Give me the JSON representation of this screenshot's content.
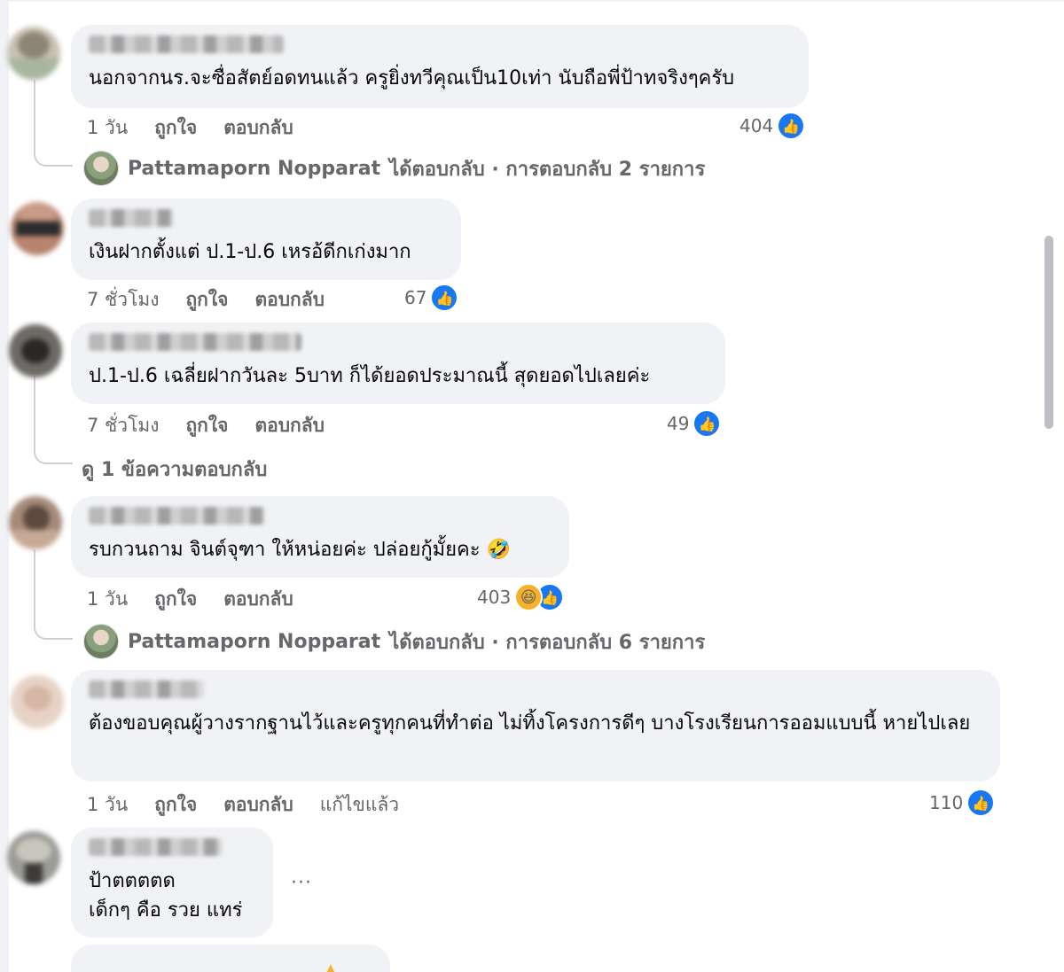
{
  "comments": [
    {
      "text": "นอกจากนร.จะซื่อสัตย์อดทนแล้ว ครูยิ่งทวีคุณเป็น10เท่า นับถือพี่ป้าทจริงๆครับ",
      "time": "1 วัน",
      "like": "ถูกใจ",
      "reply": "ตอบกลับ",
      "reaction_count": "404",
      "replies_summary": {
        "author": "Pattamaporn Nopparat",
        "text": "ได้ตอบกลับ · การตอบกลับ 2 รายการ"
      }
    },
    {
      "text": "เงินฝากตั้งแต่ ป.1-ป.6 เหรอ้ดีกเก่งมาก",
      "time": "7 ชั่วโมง",
      "like": "ถูกใจ",
      "reply": "ตอบกลับ",
      "reaction_count": "67"
    },
    {
      "text": "ป.1-ป.6 เฉลี่ยฝากวันละ 5บาท ก็ได้ยอดประมาณนี้ สุดยอดไปเลยค่ะ",
      "time": "7 ชั่วโมง",
      "like": "ถูกใจ",
      "reply": "ตอบกลับ",
      "reaction_count": "49",
      "view_replies": "ดู 1 ข้อความตอบกลับ"
    },
    {
      "text": "รบกวนถาม จินต์จุฑา ให้หน่อยค่ะ ปล่อยกู้มั้ยคะ 🤣",
      "time": "1 วัน",
      "like": "ถูกใจ",
      "reply": "ตอบกลับ",
      "reaction_count": "403",
      "replies_summary": {
        "author": "Pattamaporn Nopparat",
        "text": "ได้ตอบกลับ · การตอบกลับ 6 รายการ"
      }
    },
    {
      "text": "ต้องขอบคุณผู้วางรากฐานไว้และครูทุกคนที่ทำต่อ ไม่ทิ้งโครงการดีๆ บางโรงเรียนการออมแบบนี้ หายไปเลย",
      "time": "1 วัน",
      "like": "ถูกใจ",
      "reply": "ตอบกลับ",
      "edited": "แก้ไขแล้ว",
      "reaction_count": "110"
    },
    {
      "text_line1": "ป้าตตตตด",
      "text_line2": "เด็กๆ คือ รวย แทร่",
      "more": "···"
    }
  ],
  "icons": {
    "like": "like-icon",
    "haha": "haha-icon",
    "more": "more-options-icon"
  },
  "colors": {
    "bubble": "#f0f2f5",
    "like_blue": "#1877f2",
    "meta_gray": "#65676b"
  }
}
